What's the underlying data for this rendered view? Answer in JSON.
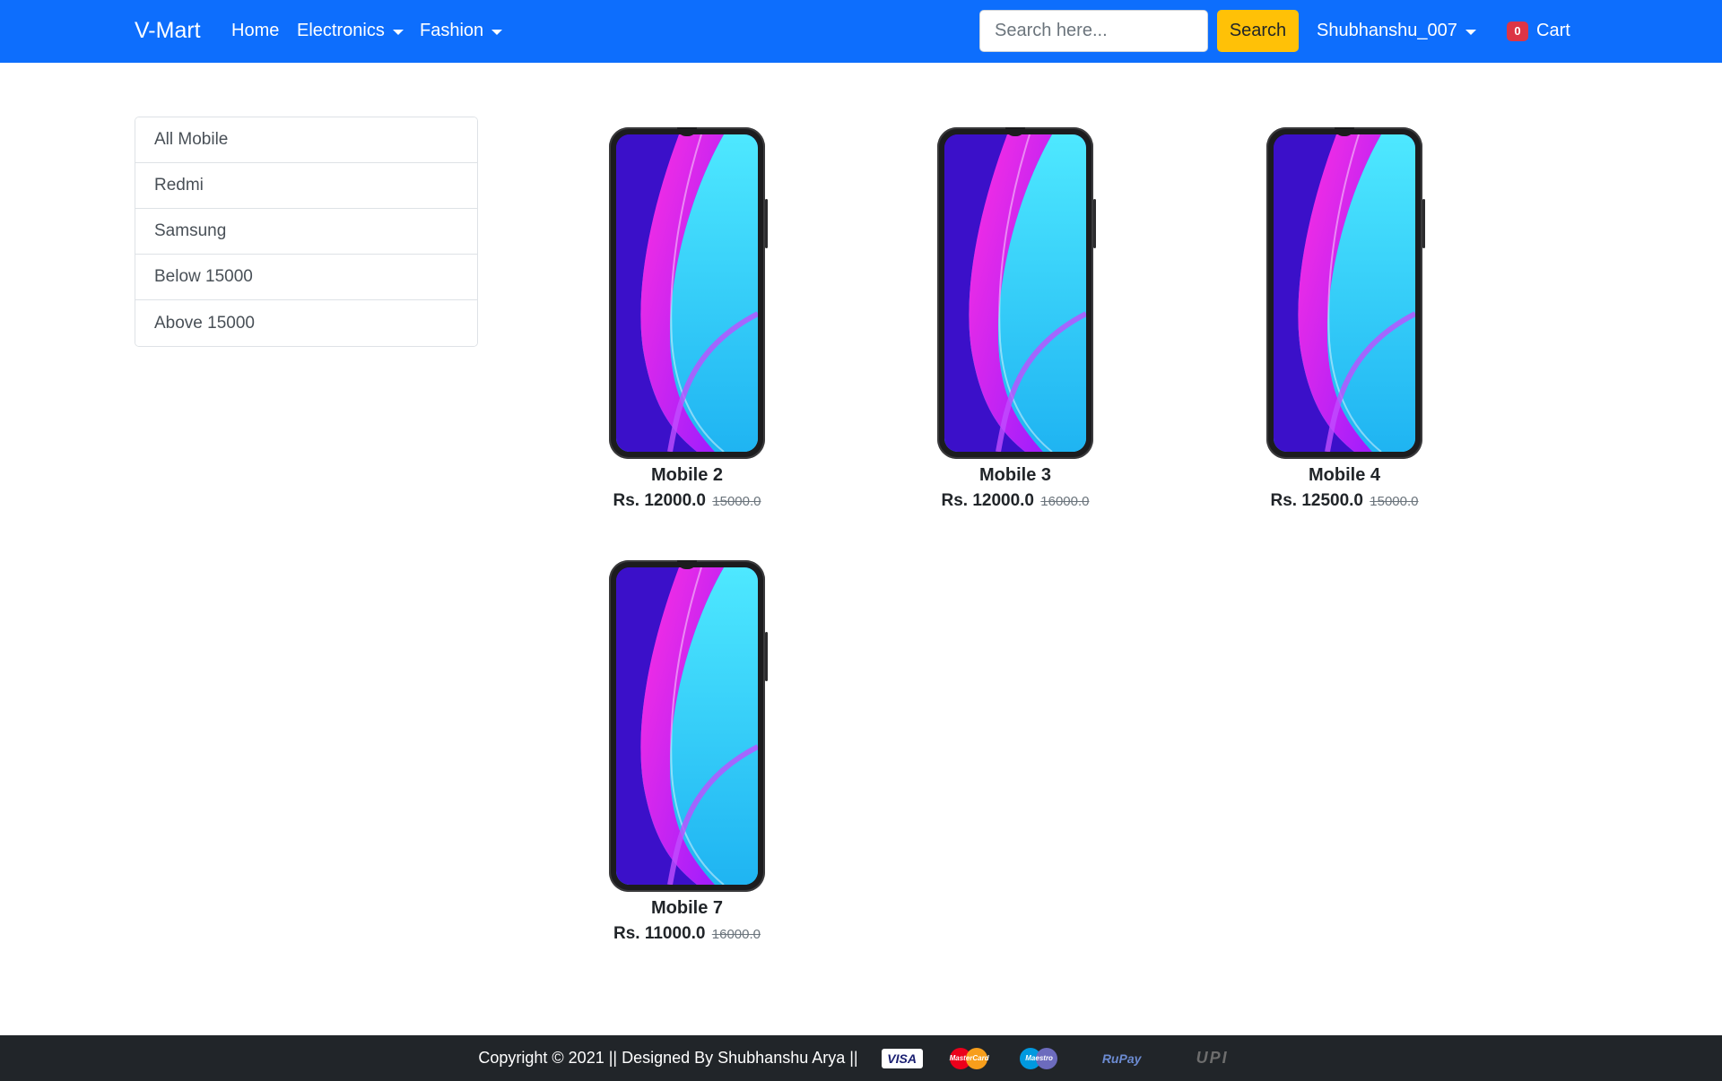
{
  "navbar": {
    "brand": "V-Mart",
    "links": [
      {
        "label": "Home",
        "dropdown": false
      },
      {
        "label": "Electronics",
        "dropdown": true
      },
      {
        "label": "Fashion",
        "dropdown": true
      }
    ],
    "search": {
      "placeholder": "Search here...",
      "value": "",
      "button_label": "Search"
    },
    "user": {
      "label": "Shubhanshu_007"
    },
    "cart": {
      "count": "0",
      "label": "Cart"
    },
    "colors": {
      "primary": "#0d6efd",
      "search_button": "#ffc107",
      "badge": "#dc3545"
    }
  },
  "sidebar": {
    "items": [
      {
        "label": "All Mobile"
      },
      {
        "label": "Redmi"
      },
      {
        "label": "Samsung"
      },
      {
        "label": "Below 15000"
      },
      {
        "label": "Above 15000"
      }
    ]
  },
  "products": [
    {
      "name": "Mobile 2",
      "price": "Rs. 12000.0",
      "old_price": "15000.0",
      "image": "phone-image"
    },
    {
      "name": "Mobile 3",
      "price": "Rs. 12000.0",
      "old_price": "16000.0",
      "image": "phone-image"
    },
    {
      "name": "Mobile 4",
      "price": "Rs. 12500.0",
      "old_price": "15000.0",
      "image": "phone-image"
    },
    {
      "name": "Mobile 7",
      "price": "Rs. 11000.0",
      "old_price": "16000.0",
      "image": "phone-image"
    }
  ],
  "footer": {
    "text": "Copyright © 2021 || Designed By Shubhanshu Arya ||",
    "payment_logos": [
      {
        "name": "visa-logo",
        "text": "VISA"
      },
      {
        "name": "mastercard-logo",
        "text": "MasterCard"
      },
      {
        "name": "maestro-logo",
        "text": "Maestro"
      },
      {
        "name": "rupay-logo",
        "text": "RuPay"
      },
      {
        "name": "upi-logo",
        "text": "UPI"
      }
    ],
    "background": "#212529"
  }
}
